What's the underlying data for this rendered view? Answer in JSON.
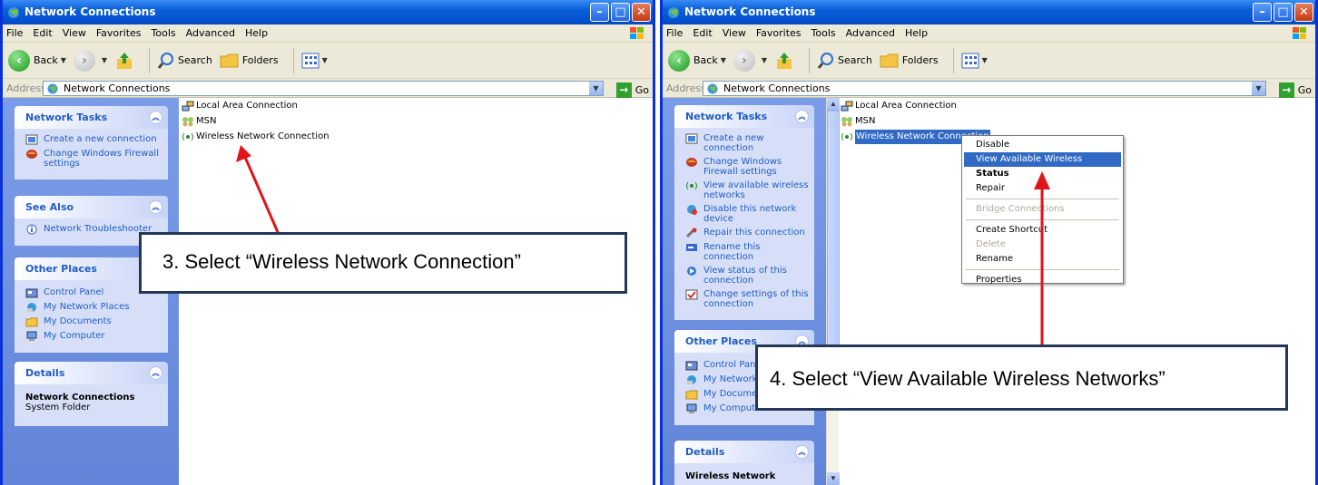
{
  "colors": {
    "titlebar": "#0550d0",
    "task_pane": "#6284d8",
    "task_text": "#215dc6",
    "selection": "#316ac5",
    "arrow": "#e0151b",
    "callout_border": "#233756"
  },
  "windows": [
    {
      "title": "Network Connections",
      "menu": [
        "File",
        "Edit",
        "View",
        "Favorites",
        "Tools",
        "Advanced",
        "Help"
      ],
      "toolbar": {
        "back": "Back",
        "search": "Search",
        "folders": "Folders"
      },
      "address": {
        "label": "Address",
        "value": "Network Connections",
        "go": "Go"
      },
      "network_tasks": {
        "title": "Network Tasks",
        "items": [
          "Create a new connection",
          "Change Windows Firewall settings"
        ]
      },
      "see_also": {
        "title": "See Also",
        "items": [
          "Network Troubleshooter"
        ]
      },
      "other_places": {
        "title": "Other Places",
        "items": [
          "Control Panel",
          "My Network Places",
          "My Documents",
          "My Computer"
        ]
      },
      "details": {
        "title": "Details",
        "name": "Network Connections",
        "type": "System Folder"
      },
      "connections": [
        "Local Area Connection",
        "MSN",
        "Wireless Network Connection"
      ],
      "callout": "3. Select “Wireless Network Connection”"
    },
    {
      "title": "Network Connections",
      "menu": [
        "File",
        "Edit",
        "View",
        "Favorites",
        "Tools",
        "Advanced",
        "Help"
      ],
      "toolbar": {
        "back": "Back",
        "search": "Search",
        "folders": "Folders"
      },
      "address": {
        "label": "Address",
        "value": "Network Connections",
        "go": "Go"
      },
      "network_tasks": {
        "title": "Network Tasks",
        "items": [
          "Create a new connection",
          "Change Windows Firewall settings",
          "View available wireless networks",
          "Disable this network device",
          "Repair this connection",
          "Rename this connection",
          "View status of this connection",
          "Change settings of this connection"
        ]
      },
      "other_places": {
        "title": "Other Places",
        "items": [
          "Control Panel",
          "My Network Places",
          "My Documents",
          "My Computer"
        ]
      },
      "details": {
        "title": "Details",
        "name": "Wireless Network"
      },
      "connections": [
        "Local Area Connection",
        "MSN",
        "Wireless Network Connection"
      ],
      "context_menu": [
        "Disable",
        "View Available Wireless Networks",
        "Status",
        "Repair",
        "Bridge Connections",
        "Create Shortcut",
        "Delete",
        "Rename",
        "Properties"
      ],
      "callout": "4. Select “View Available Wireless Networks”"
    }
  ]
}
